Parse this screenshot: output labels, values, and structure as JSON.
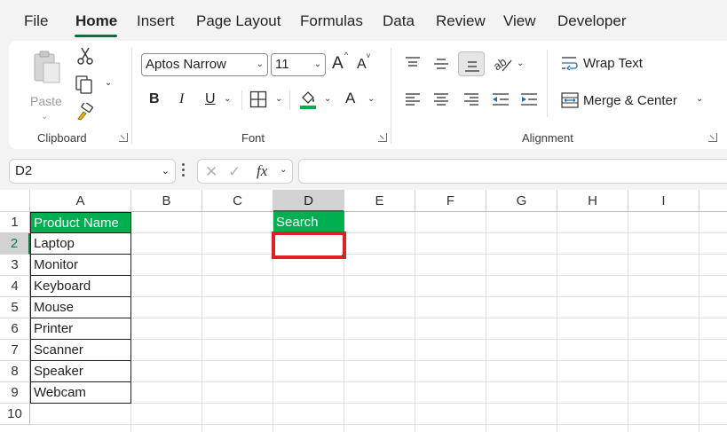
{
  "menu": {
    "tabs": [
      "File",
      "Home",
      "Insert",
      "Page Layout",
      "Formulas",
      "Data",
      "Review",
      "View",
      "Developer"
    ],
    "active_tab": "Home"
  },
  "ribbon": {
    "clipboard": {
      "paste_label": "Paste",
      "group_label": "Clipboard",
      "icons": [
        "paste-icon",
        "cut-icon",
        "copy-icon",
        "format-painter-icon"
      ]
    },
    "font": {
      "font_name": "Aptos Narrow",
      "font_size": "11",
      "group_label": "Font",
      "bold": "B",
      "italic": "I",
      "underline": "U",
      "grow_font": "A",
      "shrink_font": "A",
      "font_color": "A",
      "fill_color": "#00b050",
      "font_color_bar": "#e02027"
    },
    "alignment": {
      "wrap_text_label": "Wrap Text",
      "merge_center_label": "Merge & Center",
      "group_label": "Alignment"
    }
  },
  "formula_bar": {
    "name_box": "D2",
    "fx_label": "fx",
    "formula": ""
  },
  "grid": {
    "columns": [
      "A",
      "B",
      "C",
      "D",
      "E",
      "F",
      "G",
      "H",
      "I"
    ],
    "rows": [
      "1",
      "2",
      "3",
      "4",
      "5",
      "6",
      "7",
      "8",
      "9",
      "10"
    ],
    "selected_column": "D",
    "selected_row": "2",
    "header_fill": "#00b050",
    "cells": {
      "A1": "Product Name",
      "A2": "Laptop",
      "A3": "Monitor",
      "A4": "Keyboard",
      "A5": "Mouse",
      "A6": "Printer",
      "A7": "Scanner",
      "A8": "Speaker",
      "A9": "Webcam",
      "D1": "Search",
      "D2": ""
    }
  }
}
